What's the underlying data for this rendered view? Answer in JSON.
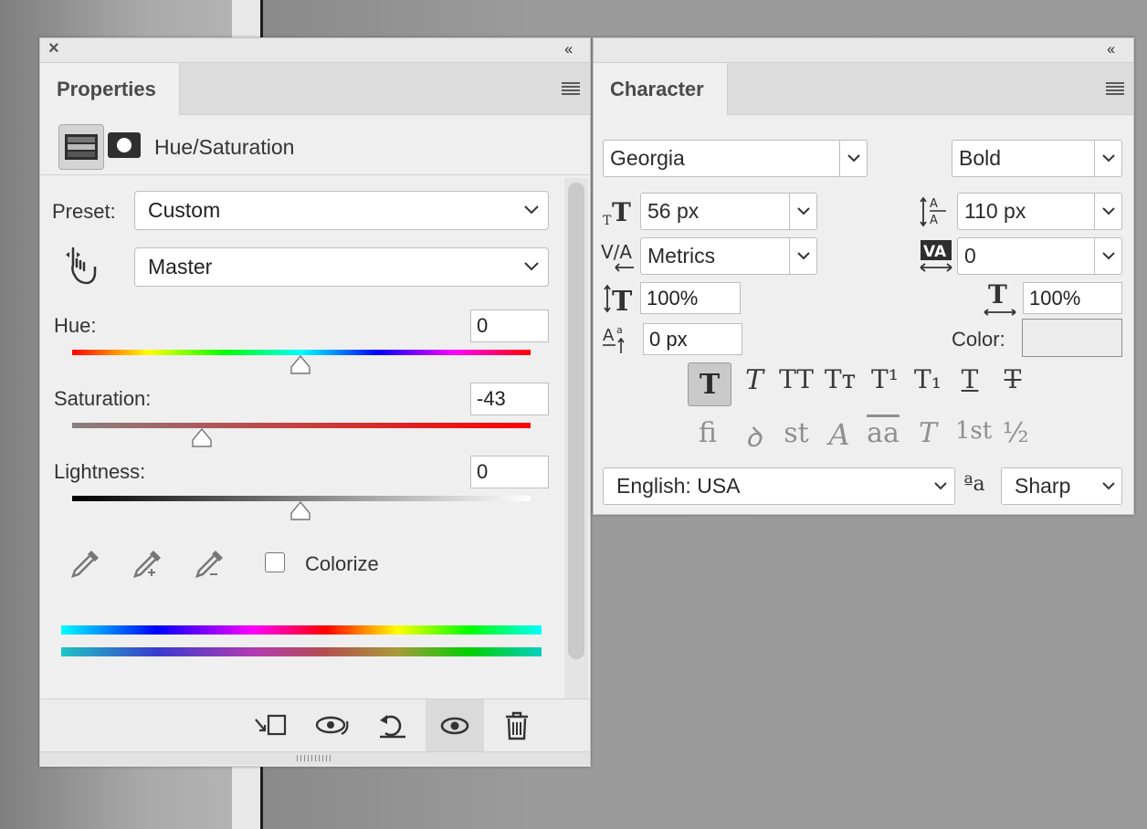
{
  "properties": {
    "tab_title": "Properties",
    "adjustment_name": "Hue/Saturation",
    "preset_label": "Preset:",
    "preset_value": "Custom",
    "channel_value": "Master",
    "hue_label": "Hue:",
    "hue_value": "0",
    "saturation_label": "Saturation:",
    "saturation_value": "-43",
    "lightness_label": "Lightness:",
    "lightness_value": "0",
    "colorize_label": "Colorize",
    "colorize_checked": false,
    "collapse_glyph": "‹‹",
    "close_glyph": "×"
  },
  "character": {
    "tab_title": "Character",
    "font_family": "Georgia",
    "font_style": "Bold",
    "font_size": "56 px",
    "leading": "110 px",
    "kerning": "Metrics",
    "tracking": "0",
    "vertical_scale": "100%",
    "horizontal_scale": "100%",
    "baseline_shift": "0 px",
    "color_label": "Color:",
    "language": "English: USA",
    "antialias_icon_text": "ªa",
    "antialias": "Sharp",
    "collapse_glyph": "‹‹",
    "style_buttons": [
      "T",
      "T",
      "TT",
      "Tт",
      "T¹",
      "T₁",
      "T",
      "T"
    ],
    "opentype_buttons": [
      "fi",
      "ꝺ",
      "st",
      "A",
      "aa",
      "T",
      "1st",
      "½"
    ]
  },
  "colors": {
    "accent_swatch": "#efefef",
    "panel_bg": "#efefef"
  }
}
